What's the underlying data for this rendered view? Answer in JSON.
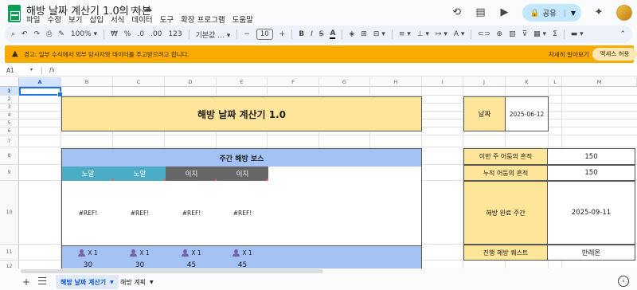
{
  "app": {
    "title": "해방 날짜 계산기 1.0의 사본",
    "menu": [
      "파일",
      "수정",
      "보기",
      "삽입",
      "서식",
      "데이터",
      "도구",
      "확장 프로그램",
      "도움말"
    ],
    "share_label": "공유"
  },
  "toolbar": {
    "zoom": "100%",
    "currency": "₩",
    "percent": "%",
    "decimal_dec": ".0",
    "decimal_inc": ".00",
    "number_format": "123",
    "font": "기본값 ...",
    "font_size": "10",
    "bold": "B",
    "italic": "I",
    "strike": "S",
    "text_color": "A"
  },
  "warning": {
    "text": "경고: 일부 수식에서 외부 당사자와 데이터를 주고받으려고 합니다.",
    "learn_more": "자세히 알아보기",
    "allow_button": "액세스 허용"
  },
  "formula_bar": {
    "name_box": "A1",
    "fx": "fx"
  },
  "grid": {
    "columns": [
      "A",
      "B",
      "C",
      "D",
      "E",
      "F",
      "G",
      "H",
      "I",
      "J",
      "K",
      "L",
      "M"
    ],
    "rows": [
      "1",
      "2",
      "3",
      "4",
      "5",
      "6",
      "7",
      "8",
      "9",
      "10",
      "11",
      "12"
    ]
  },
  "sheet": {
    "title": "해방 날짜 계산기 1.0",
    "date_label": "날짜",
    "date_value": "2025-06-12",
    "boss_header": "주간 해방 보스",
    "difficulties": [
      "노말",
      "노말",
      "이지",
      "이지"
    ],
    "refs": [
      "#REF!",
      "#REF!",
      "#REF!",
      "#REF!"
    ],
    "party_labels": [
      "X 1",
      "X 1",
      "X 1",
      "X 1"
    ],
    "party_values": [
      "30",
      "30",
      "45",
      "45"
    ],
    "stats": [
      {
        "label": "이번 주 어둠의 흔적",
        "value": "150"
      },
      {
        "label": "누적 어둠의 흔적",
        "value": "150"
      },
      {
        "label": "해방 완료 주간",
        "value": "2025-09-11"
      },
      {
        "label": "진행 해방 퀘스트",
        "value": "반레온"
      }
    ]
  },
  "tabs": [
    {
      "label": "해방 날짜 계산기",
      "active": true
    },
    {
      "label": "해방 계획",
      "active": false
    }
  ],
  "colors": {
    "yellow": "#ffe599",
    "blue": "#a4c2f4",
    "normal": "#4bacc6",
    "easy": "#666666",
    "warning": "#f9ab00"
  }
}
